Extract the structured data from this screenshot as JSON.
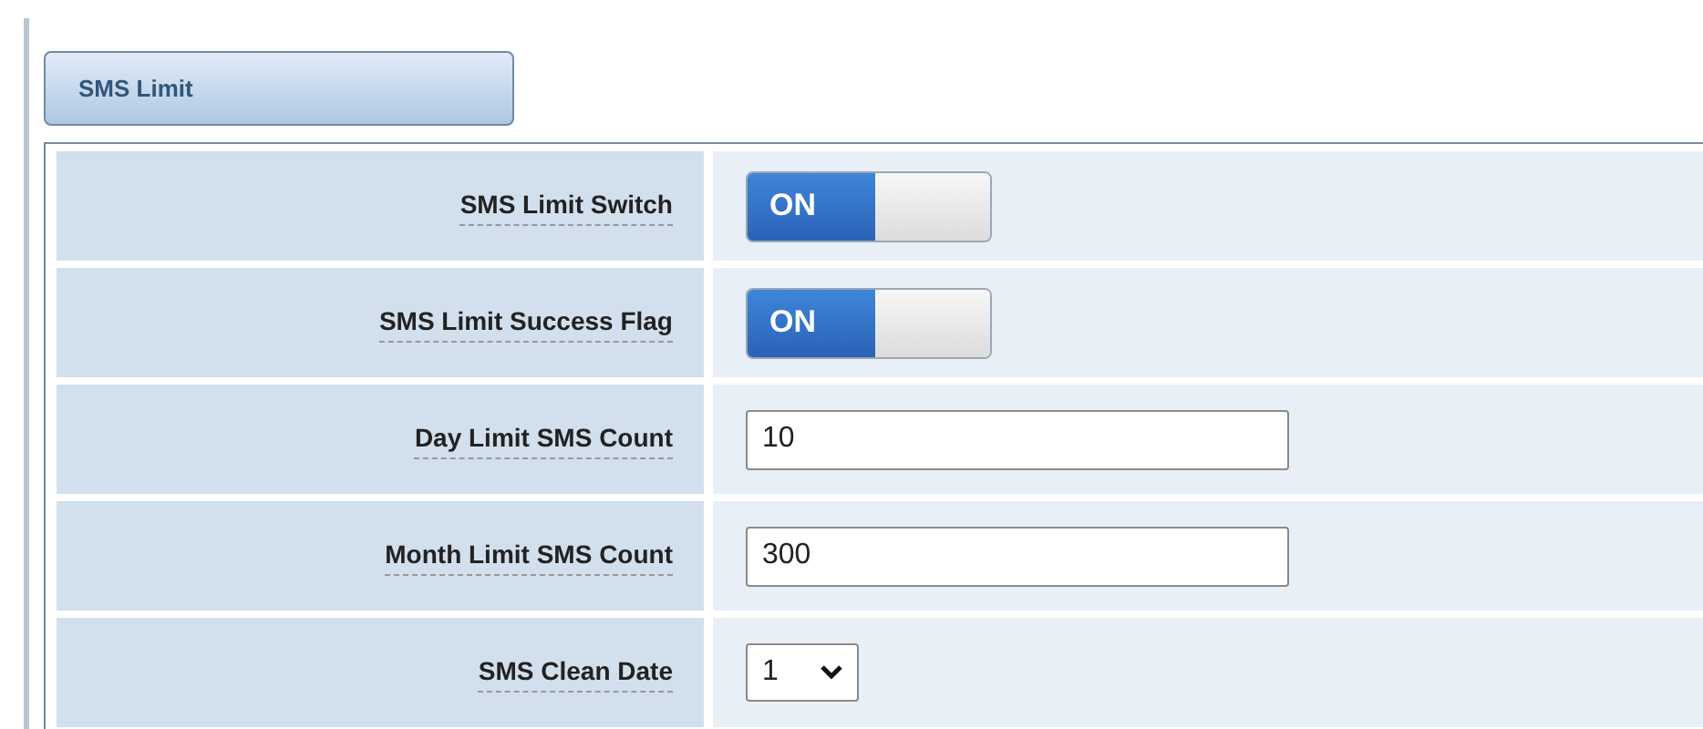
{
  "section": {
    "title": "SMS Limit"
  },
  "rows": [
    {
      "label": "SMS Limit Switch",
      "kind": "switch",
      "on": true,
      "text": "ON"
    },
    {
      "label": "SMS Limit Success Flag",
      "kind": "switch",
      "on": true,
      "text": "ON"
    },
    {
      "label": "Day Limit SMS Count",
      "kind": "text",
      "value": "10"
    },
    {
      "label": "Month Limit SMS Count",
      "kind": "text",
      "value": "300"
    },
    {
      "label": "SMS Clean Date",
      "kind": "select",
      "value": "1"
    }
  ]
}
